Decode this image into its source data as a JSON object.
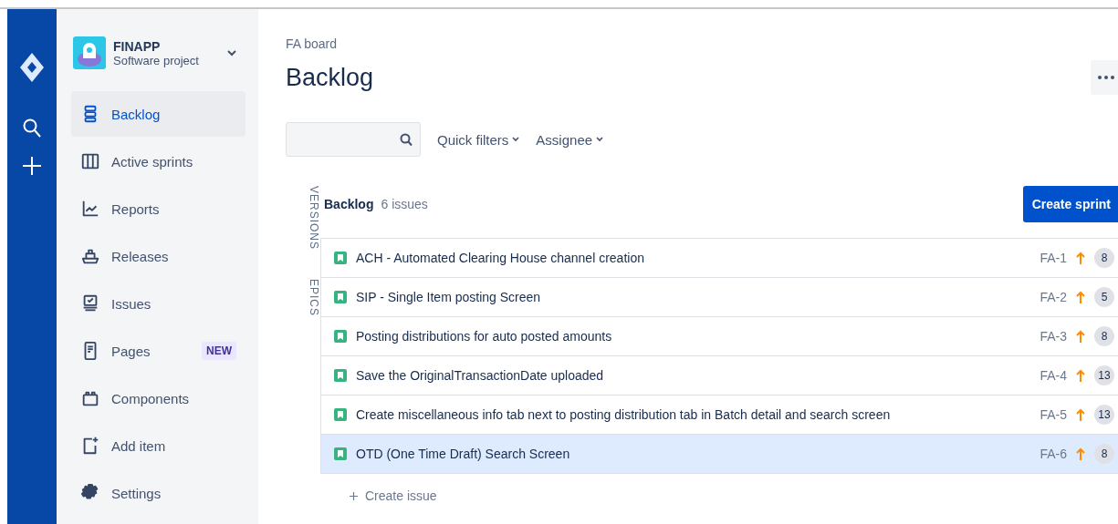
{
  "project": {
    "name": "FINAPP",
    "type": "Software project"
  },
  "sidebar": {
    "items": [
      {
        "label": "Backlog",
        "selected": true
      },
      {
        "label": "Active sprints",
        "selected": false
      },
      {
        "label": "Reports",
        "selected": false
      },
      {
        "label": "Releases",
        "selected": false
      },
      {
        "label": "Issues",
        "selected": false
      },
      {
        "label": "Pages",
        "selected": false,
        "badge": "NEW"
      },
      {
        "label": "Components",
        "selected": false
      },
      {
        "label": "Add item",
        "selected": false
      },
      {
        "label": "Settings",
        "selected": false
      }
    ]
  },
  "breadcrumb": "FA board",
  "title": "Backlog",
  "filters": [
    "Quick filters",
    "Assignee"
  ],
  "side_tabs": [
    "VERSIONS",
    "EPICS"
  ],
  "backlog": {
    "title": "Backlog",
    "count": "6 issues",
    "create_button": "Create sprint",
    "issues": [
      {
        "summary": "ACH - Automated Clearing House channel creation",
        "key": "FA-1",
        "points": "8",
        "selected": false
      },
      {
        "summary": "SIP - Single Item posting Screen",
        "key": "FA-2",
        "points": "5",
        "selected": false
      },
      {
        "summary": "Posting distributions for auto posted amounts",
        "key": "FA-3",
        "points": "8",
        "selected": false
      },
      {
        "summary": "Save the OriginalTransactionDate uploaded",
        "key": "FA-4",
        "points": "13",
        "selected": false
      },
      {
        "summary": "Create miscellaneous info tab next to posting distribution tab in Batch detail and search screen",
        "key": "FA-5",
        "points": "13",
        "selected": false
      },
      {
        "summary": "OTD (One Time Draft) Search Screen",
        "key": "FA-6",
        "points": "8",
        "selected": true
      }
    ],
    "create_issue": "Create issue"
  }
}
